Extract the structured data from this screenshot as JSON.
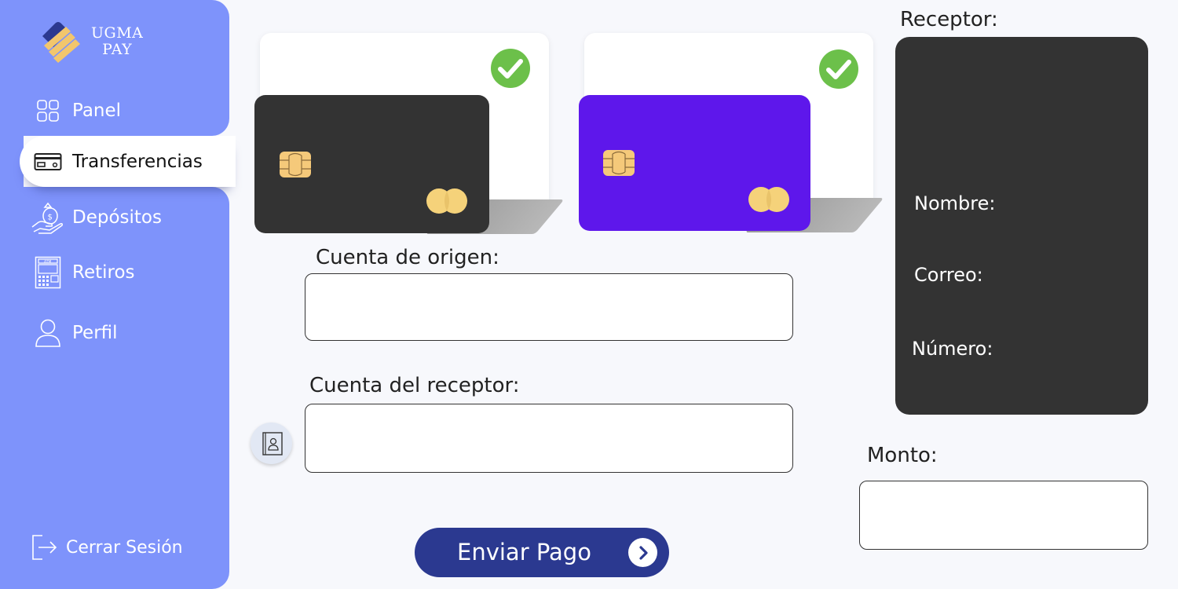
{
  "brand": {
    "line1": "UGMA",
    "line2": "PAY"
  },
  "sidebar": {
    "items": [
      {
        "label": "Panel",
        "icon": "grid-icon"
      },
      {
        "label": "Transferencias",
        "icon": "credit-card-icon",
        "active": true
      },
      {
        "label": "Depósitos",
        "icon": "money-bag-hand-icon"
      },
      {
        "label": "Retiros",
        "icon": "atm-icon"
      },
      {
        "label": "Perfil",
        "icon": "user-icon"
      }
    ],
    "logout_label": "Cerrar Sesión"
  },
  "cards": [
    {
      "color": "#333333",
      "selected": true
    },
    {
      "color": "#5e17eb",
      "selected": true
    }
  ],
  "form": {
    "origin_label": "Cuenta de origen:",
    "origin_value": "",
    "receiver_label": "Cuenta del receptor:",
    "receiver_value": "",
    "amount_label": "Monto:",
    "amount_value": "",
    "send_label": "Enviar Pago"
  },
  "receiver": {
    "title": "Receptor:",
    "name_label": "Nombre:",
    "email_label": "Correo:",
    "number_label": "Número:"
  },
  "colors": {
    "sidebar": "#7e93fb",
    "accent": "#2b3990",
    "check": "#6cc04a",
    "chip": "#f5c97a",
    "panel": "#333333"
  }
}
